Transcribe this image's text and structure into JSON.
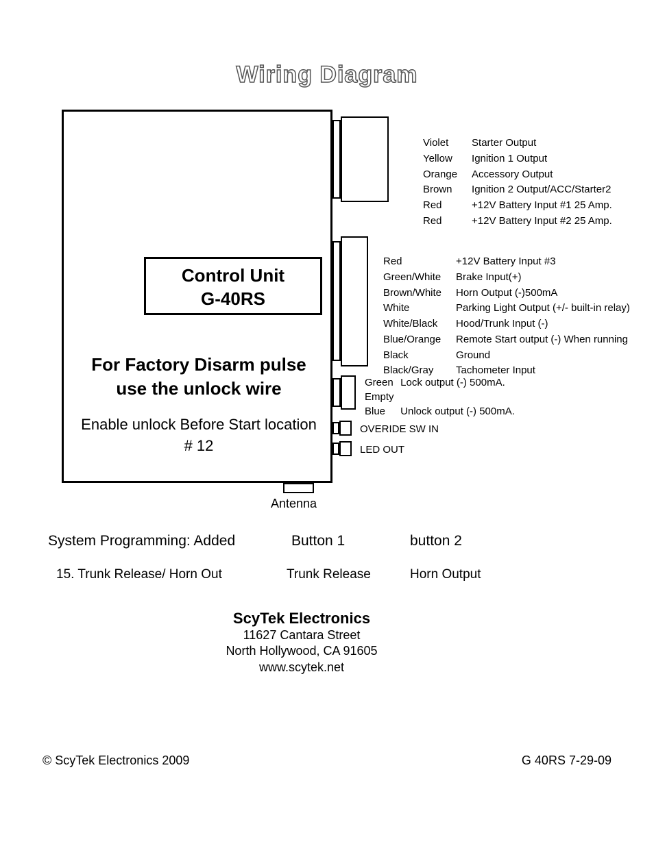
{
  "title": "Wiring Diagram",
  "control_unit": {
    "line1": "Control Unit",
    "line2": "G-40RS"
  },
  "disarm": {
    "line1": "For Factory Disarm pulse",
    "line2": "use the unlock wire"
  },
  "enable": {
    "line1": "Enable unlock Before Start location",
    "line2": "# 12"
  },
  "antenna_label": "Antenna",
  "connA": [
    {
      "color": "Violet",
      "desc": "Starter Output"
    },
    {
      "color": "Yellow",
      "desc": "Ignition 1 Output"
    },
    {
      "color": "Orange",
      "desc": "Accessory Output"
    },
    {
      "color": "Brown",
      "desc": "Ignition 2 Output/ACC/Starter2"
    },
    {
      "color": "Red",
      "desc": "+12V Battery Input #1  25 Amp."
    },
    {
      "color": "Red",
      "desc": "+12V Battery Input #2  25 Amp."
    }
  ],
  "connB": [
    {
      "color": "Red",
      "desc": "+12V Battery Input #3"
    },
    {
      "color": "Green/White",
      "desc": "Brake Input(+)"
    },
    {
      "color": "Brown/White",
      "desc": "Horn Output (-)500mA"
    },
    {
      "color": "White",
      "desc": "Parking Light Output (+/- built-in relay)"
    },
    {
      "color": "White/Black",
      "desc": "Hood/Trunk Input (-)"
    },
    {
      "color": "Blue/Orange",
      "desc": "Remote Start output (-) When running"
    },
    {
      "color": "Black",
      "desc": "Ground"
    },
    {
      "color": "Black/Gray",
      "desc": "Tachometer Input"
    }
  ],
  "connC": [
    {
      "color": "Green",
      "desc": "Lock output    (-) 500mA."
    },
    {
      "color": "Empty",
      "desc": ""
    },
    {
      "color": "Blue",
      "desc": "Unlock output (-) 500mA."
    }
  ],
  "override_label": "OVERIDE SW IN",
  "led_label": "LED OUT",
  "prog": {
    "header1": "System Programming: Added",
    "header2": "Button 1",
    "header3": "button 2",
    "row1a": "15. Trunk Release/ Horn Out",
    "row1b": "Trunk Release",
    "row1c": "Horn Output"
  },
  "company": {
    "name": "ScyTek Electronics",
    "street": "11627 Cantara Street",
    "city": "North Hollywood, CA 91605",
    "web": "www.scytek.net"
  },
  "footer_left": "© ScyTek Electronics 2009",
  "footer_right": "G 40RS 7-29-09"
}
